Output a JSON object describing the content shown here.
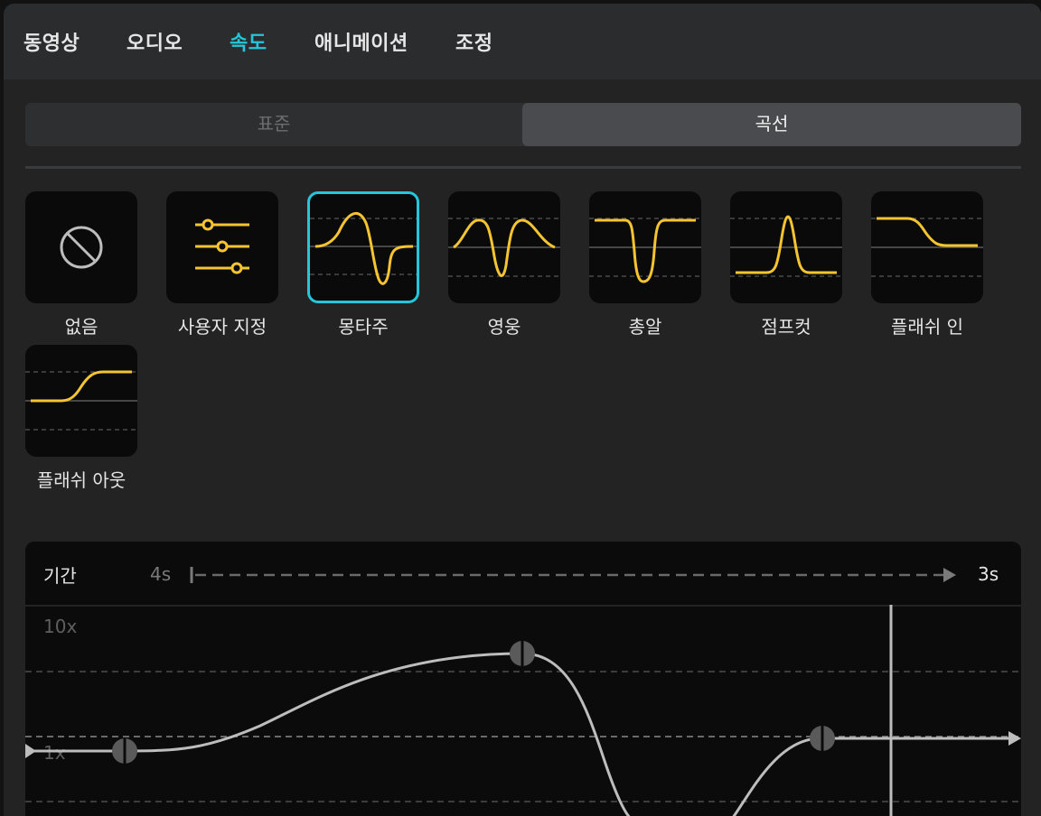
{
  "tabs": [
    {
      "label": "동영상",
      "active": false
    },
    {
      "label": "오디오",
      "active": false
    },
    {
      "label": "속도",
      "active": true
    },
    {
      "label": "애니메이션",
      "active": false
    },
    {
      "label": "조정",
      "active": false
    }
  ],
  "segment": {
    "standard": "표준",
    "curve": "곡선",
    "selected": "curve"
  },
  "presets": [
    {
      "label": "없음",
      "icon": "no-entry-icon"
    },
    {
      "label": "사용자 지정",
      "icon": "sliders-icon"
    },
    {
      "label": "몽타주",
      "icon": "montage-curve-icon",
      "selected": true
    },
    {
      "label": "영웅",
      "icon": "hero-curve-icon"
    },
    {
      "label": "총알",
      "icon": "bullet-curve-icon"
    },
    {
      "label": "점프컷",
      "icon": "jumpcut-curve-icon"
    },
    {
      "label": "플래쉬 인",
      "icon": "flash-in-curve-icon"
    },
    {
      "label": "플래쉬 아웃",
      "icon": "flash-out-curve-icon"
    }
  ],
  "duration": {
    "label": "기간",
    "from": "4s",
    "to": "3s"
  },
  "graph": {
    "y_top_label": "10x",
    "y_mid_label": "1x"
  },
  "colors": {
    "accent": "#26c6da",
    "curve_yellow": "#f5c431",
    "graph_curve": "#bdbdbd"
  }
}
